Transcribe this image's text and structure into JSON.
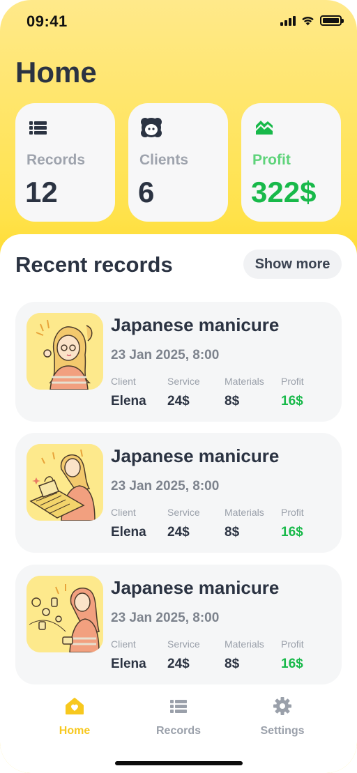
{
  "status_bar": {
    "time": "09:41"
  },
  "header": {
    "title": "Home"
  },
  "stats": [
    {
      "label": "Records",
      "value": "12",
      "icon": "list-icon"
    },
    {
      "label": "Clients",
      "value": "6",
      "icon": "client-face-icon"
    },
    {
      "label": "Profit",
      "value": "322$",
      "icon": "chart-up-icon"
    }
  ],
  "recent": {
    "title": "Recent records",
    "show_more_label": "Show more",
    "column_labels": {
      "client": "Client",
      "service": "Service",
      "materials": "Materials",
      "profit": "Profit"
    },
    "records": [
      {
        "title": "Japanese manicure",
        "date": "23 Jan 2025, 8:00",
        "client": "Elena",
        "service": "24$",
        "materials": "8$",
        "profit": "16$"
      },
      {
        "title": "Japanese manicure",
        "date": "23 Jan 2025, 8:00",
        "client": "Elena",
        "service": "24$",
        "materials": "8$",
        "profit": "16$"
      },
      {
        "title": "Japanese manicure",
        "date": "23 Jan 2025, 8:00",
        "client": "Elena",
        "service": "24$",
        "materials": "8$",
        "profit": "16$"
      }
    ]
  },
  "tab_bar": {
    "tabs": [
      {
        "label": "Home",
        "icon": "home-heart-icon",
        "active": true
      },
      {
        "label": "Records",
        "icon": "list-icon",
        "active": false
      },
      {
        "label": "Settings",
        "icon": "gear-icon",
        "active": false
      }
    ]
  },
  "colors": {
    "accent_yellow": "#ffd92a",
    "profit_green": "#18b94a",
    "text_dark": "#2b3342",
    "muted": "#9aa0aa"
  }
}
